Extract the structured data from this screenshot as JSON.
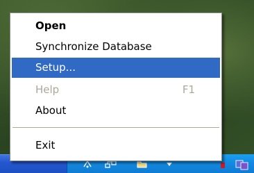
{
  "context_menu": {
    "items": [
      {
        "label": "Open",
        "shortcut": "",
        "state": "default-bold"
      },
      {
        "label": "Synchronize Database",
        "shortcut": "",
        "state": "normal"
      },
      {
        "label": "Setup...",
        "shortcut": "",
        "state": "highlighted"
      },
      {
        "label": "Help",
        "shortcut": "F1",
        "state": "disabled"
      },
      {
        "label": "About",
        "shortcut": "",
        "state": "normal"
      },
      {
        "label": "Exit",
        "shortcut": "",
        "state": "normal"
      }
    ]
  },
  "colors": {
    "highlight": "#316ac5",
    "disabled_text": "#aca899",
    "taskbar": "#2457cf",
    "tray": "#138be0"
  },
  "tray_icons": [
    "network-icon",
    "connection-icon",
    "folder-icon",
    "chevron-down-icon",
    "app-tray-icon"
  ]
}
